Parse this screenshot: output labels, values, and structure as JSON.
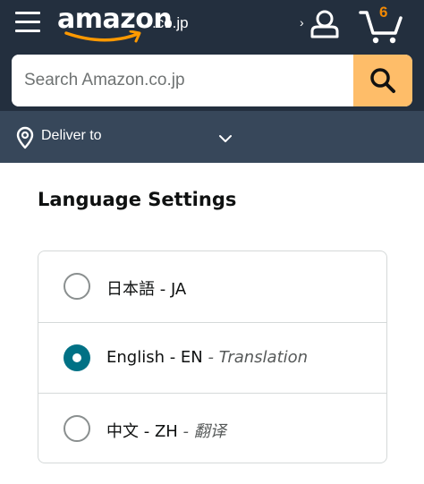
{
  "header": {
    "logo_word": "amazon",
    "logo_tld": ".co.jp",
    "account_chevron": "›",
    "cart_count": "6"
  },
  "search": {
    "placeholder": "Search Amazon.co.jp",
    "value": ""
  },
  "deliver": {
    "label": "Deliver to"
  },
  "content": {
    "title": "Language Settings",
    "languages": [
      {
        "label": "日本語 - JA",
        "sub": "",
        "selected": false
      },
      {
        "label": "English - EN",
        "sub": " - Translation",
        "selected": true
      },
      {
        "label": "中文 - ZH",
        "sub": " - 翻译",
        "selected": false
      }
    ]
  },
  "colors": {
    "header_bg": "#232f3e",
    "deliver_bg": "#37475a",
    "search_button": "#febd69",
    "cart_count": "#f08804",
    "radio_selected": "#007185"
  },
  "icons": {
    "menu": "hamburger-menu-icon",
    "account": "user-icon",
    "cart": "cart-icon",
    "search": "search-icon",
    "location": "location-pin-icon",
    "dropdown": "chevron-down-icon"
  }
}
